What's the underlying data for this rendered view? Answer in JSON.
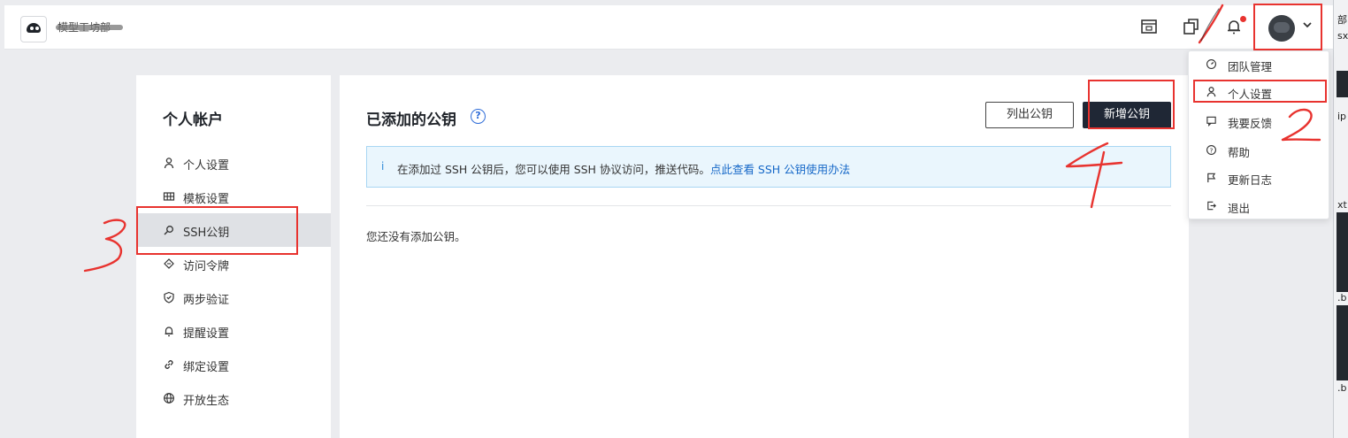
{
  "header": {
    "org_name": "模型工坊部",
    "icons": [
      "logo-icon",
      "screen-icon",
      "copy-icon",
      "bell-icon",
      "avatar",
      "chevron-down-icon"
    ]
  },
  "sidebar": {
    "title": "个人帐户",
    "items": [
      {
        "label": "个人设置",
        "icon": "user-icon"
      },
      {
        "label": "模板设置",
        "icon": "grid-icon"
      },
      {
        "label": "SSH公钥",
        "icon": "search-key-icon",
        "active": true
      },
      {
        "label": "访问令牌",
        "icon": "ticket-icon"
      },
      {
        "label": "两步验证",
        "icon": "shield-icon"
      },
      {
        "label": "提醒设置",
        "icon": "bell-icon"
      },
      {
        "label": "绑定设置",
        "icon": "link-icon"
      },
      {
        "label": "开放生态",
        "icon": "globe-icon"
      }
    ]
  },
  "main": {
    "title": "已添加的公钥",
    "list_button": "列出公钥",
    "add_button": "新增公钥",
    "info_text": "在添加过 SSH 公钥后，您可以使用 SSH 协议访问，推送代码。",
    "info_link": "点此查看 SSH 公钥使用办法",
    "empty_text": "您还没有添加公钥。"
  },
  "dropdown": {
    "items": [
      {
        "label": "团队管理",
        "icon": "dashboard-icon"
      },
      {
        "label": "个人设置",
        "icon": "user-icon"
      },
      {
        "label": "我要反馈",
        "icon": "feedback-icon"
      },
      {
        "label": "帮助",
        "icon": "help-icon"
      },
      {
        "label": "更新日志",
        "icon": "flag-icon"
      },
      {
        "label": "退出",
        "icon": "logout-icon"
      }
    ]
  },
  "annotations": {
    "marks": [
      "1",
      "2",
      "3",
      "4"
    ],
    "color": "#e8332f"
  },
  "right_strip": {
    "texts": [
      "部",
      "sx",
      "ip",
      "xt",
      ".b",
      ".b"
    ]
  },
  "colors": {
    "primary_button": "#1f2735",
    "link": "#1668c8",
    "info_bg": "#eaf6fd",
    "active_item": "#dfe1e5"
  }
}
